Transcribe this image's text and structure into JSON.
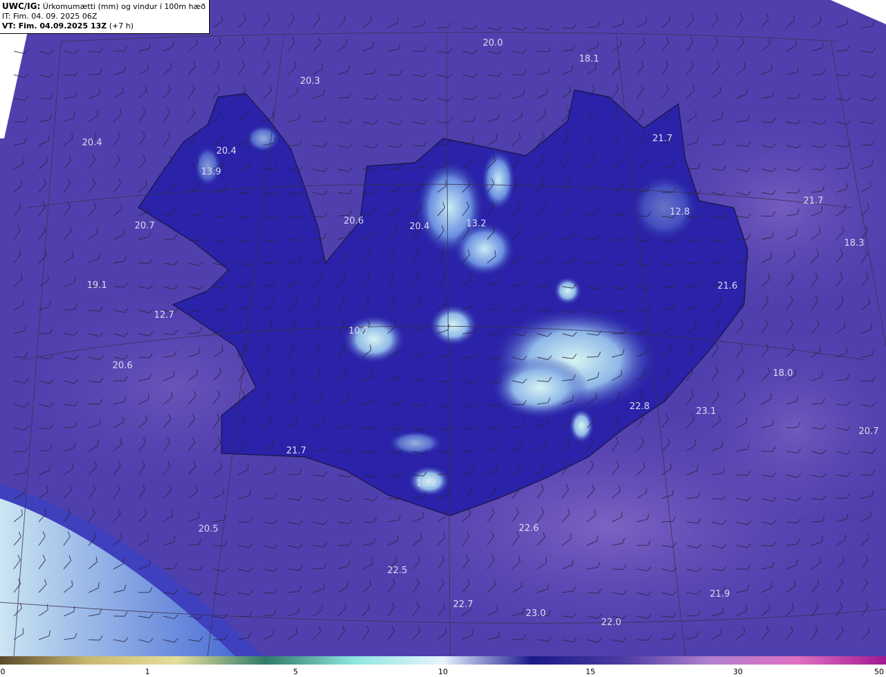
{
  "header": {
    "product": "UWC/IG:",
    "description": "Úrkomumætti (mm) og vindur í 100m hæð",
    "init_time": "IT: Fim. 04. 09. 2025 06Z",
    "valid_prefix": "VT: Fim. 04.09.2025 13Z",
    "valid_suffix": "(+7 h)"
  },
  "colorbar": {
    "ticks": [
      "0",
      "1",
      "5",
      "10",
      "15",
      "30",
      "50"
    ],
    "colors": [
      "#5a4a2a",
      "#c9b870",
      "#e6de9a",
      "#2f7a6a",
      "#8fe6e0",
      "#e6f4ff",
      "#1a1a8a",
      "#4a3aa0",
      "#b080d0",
      "#e070c0",
      "#a01890"
    ]
  },
  "values": [
    "20.0",
    "18.1",
    "20.3",
    "21.7",
    "20.4",
    "20.4",
    "13.9",
    "21.7",
    "12.8",
    "20.7",
    "20.6",
    "20.4",
    "13.2",
    "18.3",
    "19.1",
    "21.6",
    "12.7",
    "10.7",
    "18.0",
    "20.6",
    "22.8",
    "23.1",
    "20.7",
    "21.7",
    "10.9",
    "20.5",
    "22.6",
    "22.5",
    "21.9",
    "22.7",
    "23.0",
    "22.0"
  ]
}
